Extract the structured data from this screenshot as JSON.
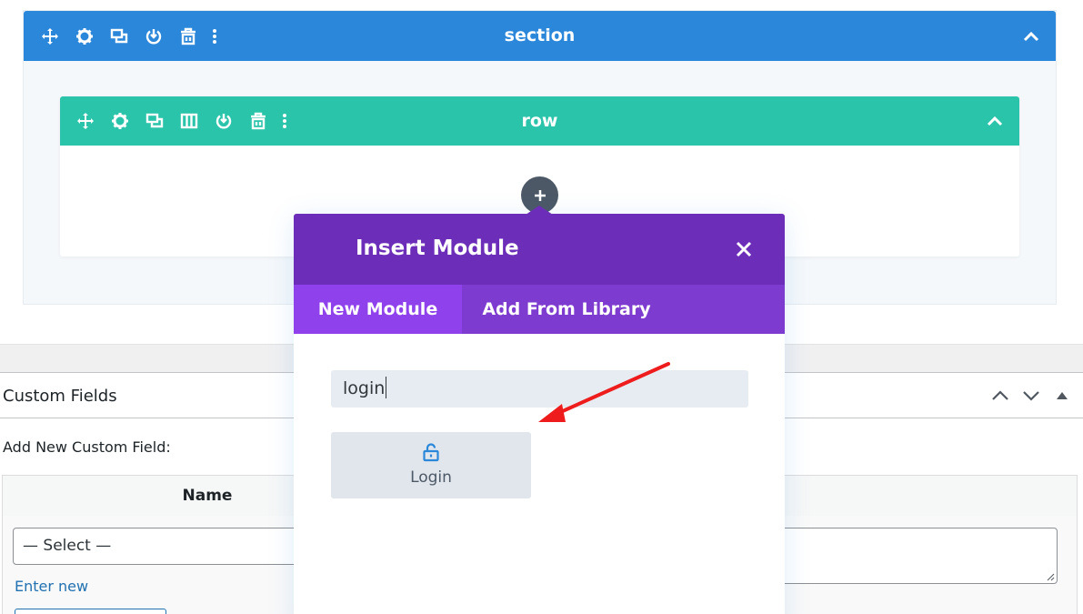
{
  "section": {
    "title": "section",
    "bar_color": "#2b87da",
    "icons": [
      "move-icon",
      "settings-gear-icon",
      "duplicate-icon",
      "save-to-library-icon",
      "delete-trash-icon",
      "more-dots-icon"
    ],
    "toggle_icon": "chevron-up-icon"
  },
  "row": {
    "title": "row",
    "bar_color": "#29c4a9",
    "icons": [
      "move-icon",
      "settings-gear-icon",
      "duplicate-icon",
      "columns-icon",
      "save-to-library-icon",
      "delete-trash-icon",
      "more-dots-icon"
    ],
    "toggle_icon": "chevron-up-icon",
    "add_button_icon": "plus-icon"
  },
  "modal": {
    "title": "Insert Module",
    "close_icon": "close-x-icon",
    "header_color": "#6c2eb9",
    "tabs": [
      {
        "label": "New Module",
        "active": true
      },
      {
        "label": "Add From Library",
        "active": false
      }
    ],
    "search_value": "login",
    "results": [
      {
        "label": "Login",
        "icon": "unlock-padlock-icon"
      }
    ]
  },
  "annotation": {
    "type": "red-arrow",
    "color": "#ee1c1c"
  },
  "custom_fields": {
    "title": "Custom Fields",
    "controls": [
      "move-up-icon",
      "move-down-icon",
      "toggle-panel-icon"
    ],
    "add_new_label": "Add New Custom Field:",
    "column_name": "Name",
    "select_value": "— Select —",
    "enter_new_link": "Enter new"
  }
}
